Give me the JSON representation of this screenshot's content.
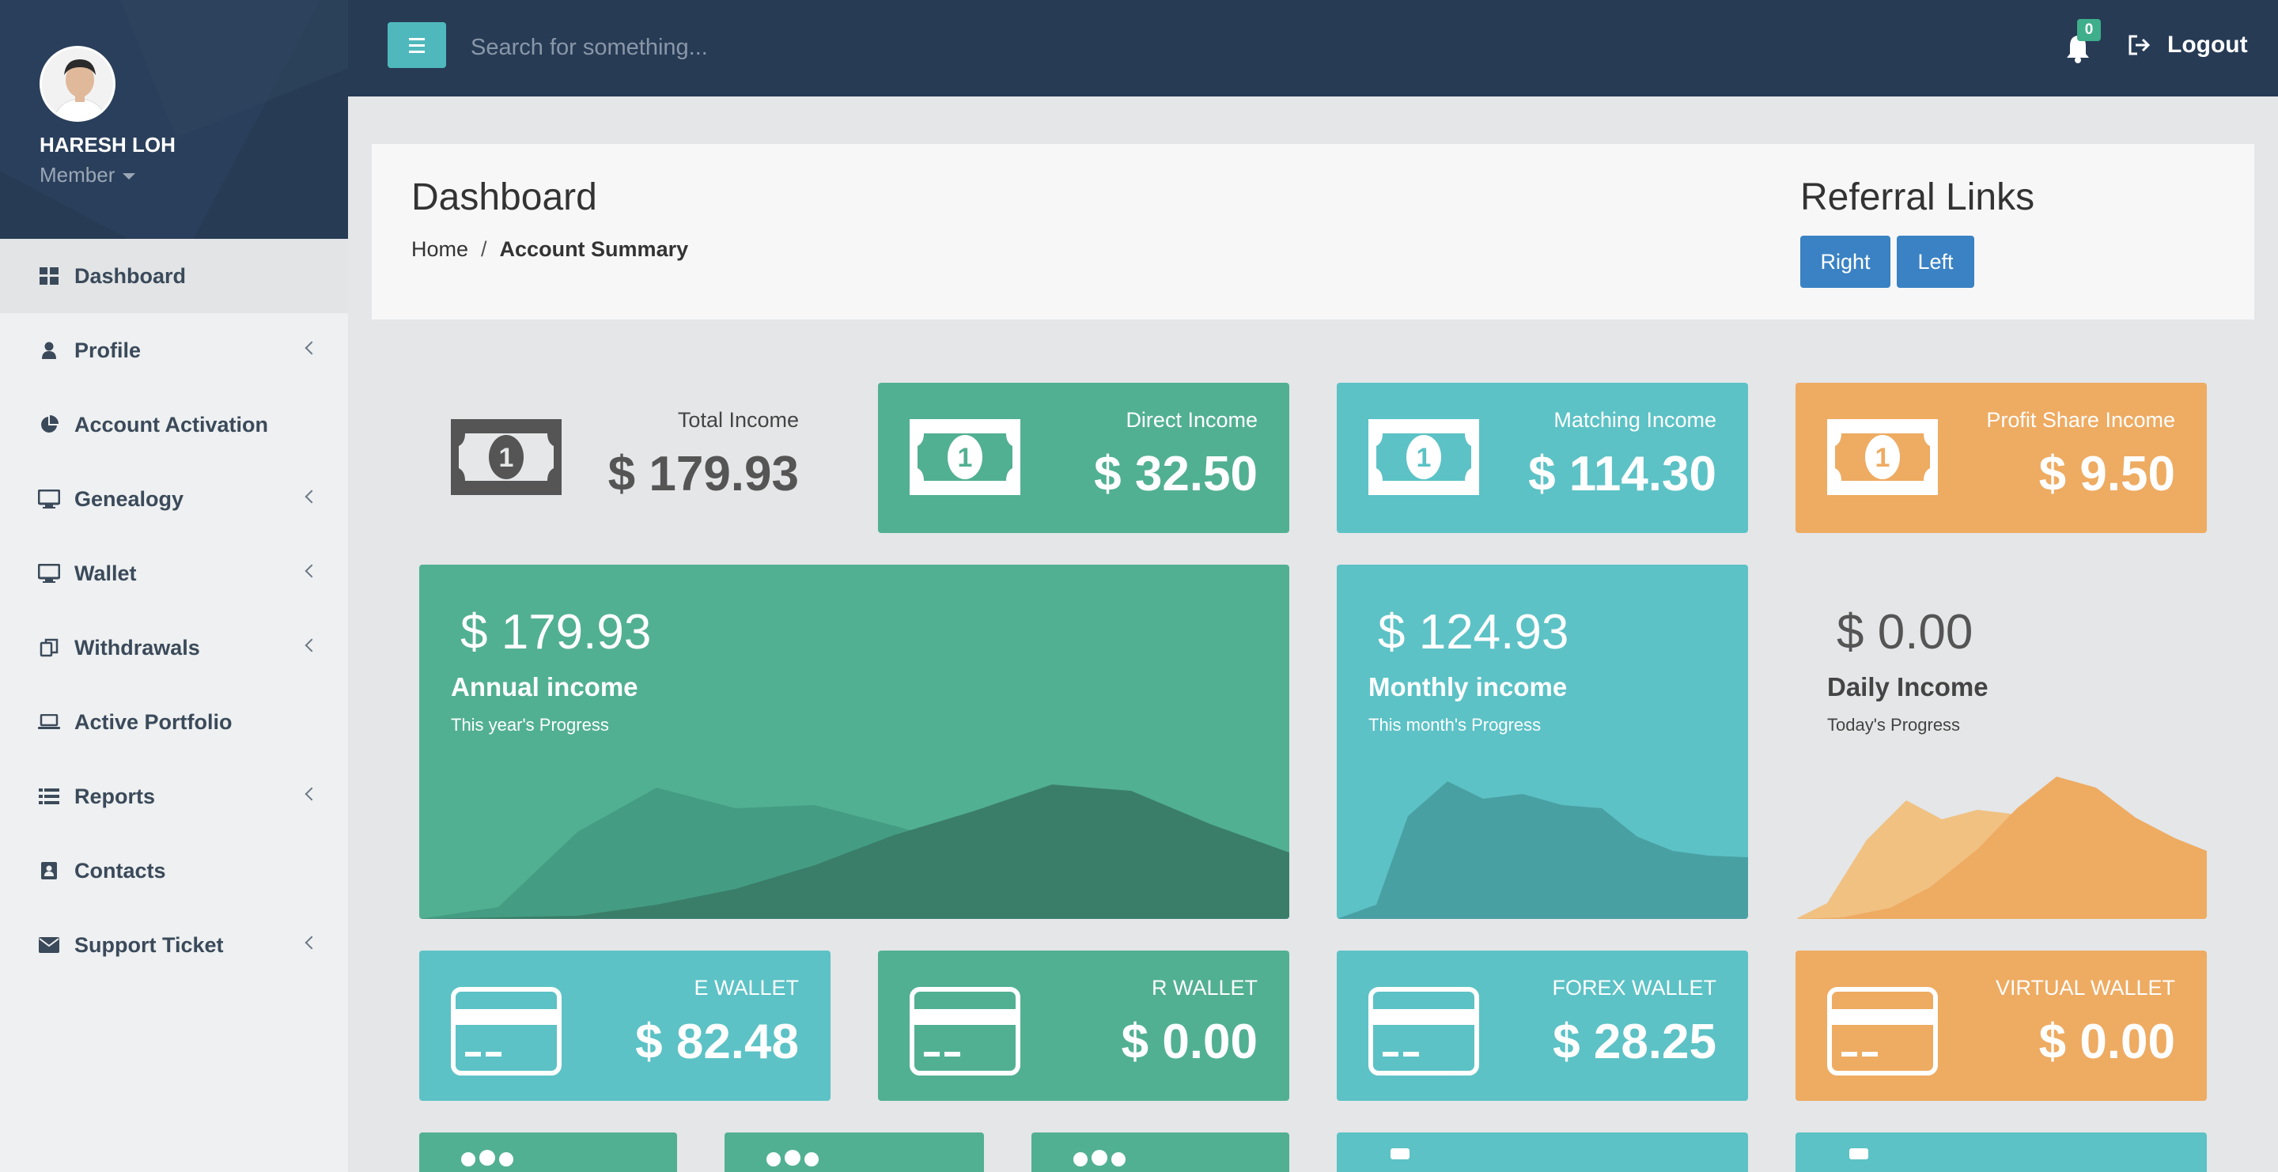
{
  "user": {
    "name": "HARESH LOH",
    "role": "Member"
  },
  "menu": [
    {
      "label": "Dashboard",
      "icon": "dashboard-icon",
      "active": true,
      "has_children": false
    },
    {
      "label": "Profile",
      "icon": "user-icon",
      "has_children": true
    },
    {
      "label": "Account Activation",
      "icon": "pie-chart-icon",
      "has_children": false
    },
    {
      "label": "Genealogy",
      "icon": "desktop-icon",
      "has_children": true
    },
    {
      "label": "Wallet",
      "icon": "desktop-icon",
      "has_children": true
    },
    {
      "label": "Withdrawals",
      "icon": "copy-icon",
      "has_children": true
    },
    {
      "label": "Active Portfolio",
      "icon": "laptop-icon",
      "has_children": false
    },
    {
      "label": "Reports",
      "icon": "list-icon",
      "has_children": true
    },
    {
      "label": "Contacts",
      "icon": "contact-card-icon",
      "has_children": false
    },
    {
      "label": "Support Ticket",
      "icon": "envelope-icon",
      "has_children": true
    }
  ],
  "topbar": {
    "search_placeholder": "Search for something...",
    "notification_count": "0",
    "logout_label": "Logout"
  },
  "header": {
    "title": "Dashboard",
    "breadcrumb_home": "Home",
    "breadcrumb_current": "Account Summary",
    "referral_title": "Referral Links",
    "referral_right": "Right",
    "referral_left": "Left"
  },
  "income_cards": [
    {
      "label": "Total Income",
      "value": "$ 179.93",
      "color": "plain"
    },
    {
      "label": "Direct Income",
      "value": "$ 32.50",
      "color": "#52b092"
    },
    {
      "label": "Matching Income",
      "value": "$ 114.30",
      "color": "#5cc2c6"
    },
    {
      "label": "Profit Share Income",
      "value": "$ 9.50",
      "color": "#eeab62"
    }
  ],
  "progress_cards": [
    {
      "value": "$ 179.93",
      "title": "Annual income",
      "subtitle": "This year's Progress",
      "color": "#52b092"
    },
    {
      "value": "$ 124.93",
      "title": "Monthly income",
      "subtitle": "This month's Progress",
      "color": "#5cc2c6"
    },
    {
      "value": "$ 0.00",
      "title": "Daily Income",
      "subtitle": "Today's Progress",
      "color": "plain"
    }
  ],
  "wallet_cards": [
    {
      "label": "E WALLET",
      "value": "$ 82.48",
      "color": "#5cc2c6"
    },
    {
      "label": "R WALLET",
      "value": "$ 0.00",
      "color": "#52b092"
    },
    {
      "label": "FOREX WALLET",
      "value": "$ 28.25",
      "color": "#5cc2c6"
    },
    {
      "label": "VIRTUAL WALLET",
      "value": "$ 0.00",
      "color": "#eeab62"
    }
  ]
}
